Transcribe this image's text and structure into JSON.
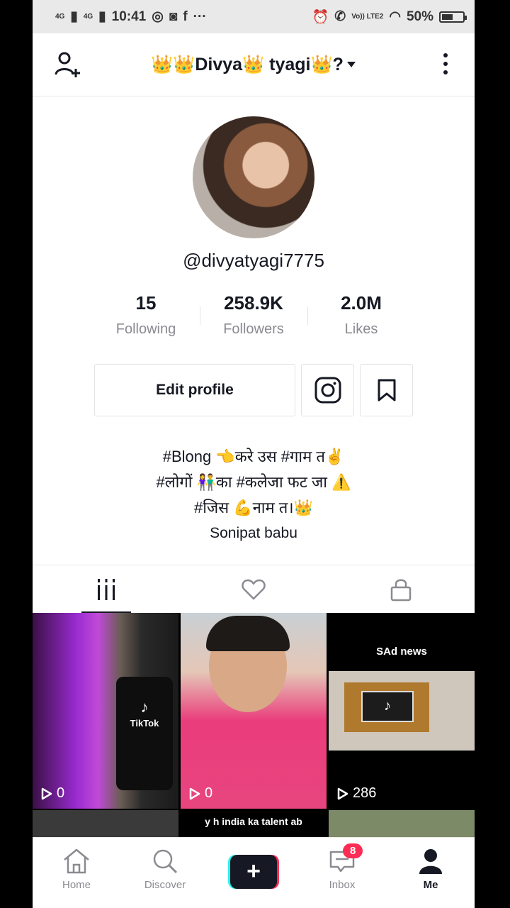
{
  "status": {
    "network1": "4G",
    "network2": "4G",
    "time": "10:41",
    "lte": "Vo)) LTE2",
    "battery": "50%"
  },
  "header": {
    "title": "👑👑Divya👑 tyagi👑?",
    "dropdown_icon": "caret-down-icon"
  },
  "profile": {
    "username": "@divyatyagi7775"
  },
  "stats": [
    {
      "value": "15",
      "label": "Following"
    },
    {
      "value": "258.9K",
      "label": "Followers"
    },
    {
      "value": "2.0M",
      "label": "Likes"
    }
  ],
  "buttons": {
    "edit_profile": "Edit profile"
  },
  "bio": {
    "line1": "#Blong 👈करे उस #गाम त✌️",
    "line2": "#लोगों 👫का #कलेजा फट जा ⚠️",
    "line3": "#जिस 💪नाम त।👑",
    "line4": "Sonipat babu"
  },
  "videos": [
    {
      "views": "0"
    },
    {
      "views": "0"
    },
    {
      "views": "286",
      "overlay": "SAd news"
    }
  ],
  "row2_caption": "y h india ka talent ab",
  "tiktok_label": "TikTok",
  "nav": {
    "home": "Home",
    "discover": "Discover",
    "inbox": "Inbox",
    "inbox_badge": "8",
    "me": "Me"
  },
  "colors": {
    "accent_red": "#fe2c55",
    "accent_cyan": "#25f4ee",
    "text": "#161823",
    "muted": "#8a8b91"
  }
}
